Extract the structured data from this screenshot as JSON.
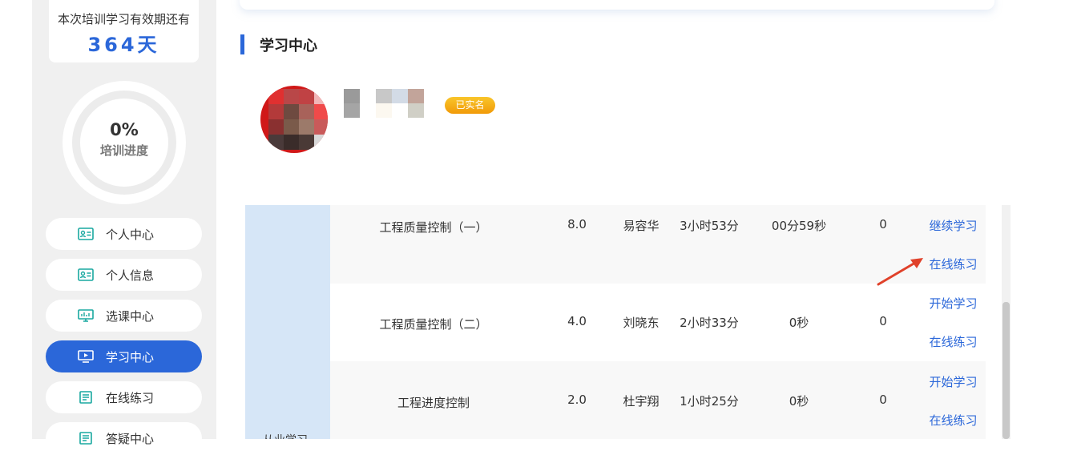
{
  "validity": {
    "label": "本次培训学习有效期还有",
    "days": "364天"
  },
  "progress": {
    "percent_text": "0%",
    "label": "培训进度",
    "value": 0
  },
  "menu": [
    {
      "label": "个人中心",
      "icon": "id-card-icon"
    },
    {
      "label": "个人信息",
      "icon": "id-card-icon"
    },
    {
      "label": "选课中心",
      "icon": "monitor-icon"
    },
    {
      "label": "学习中心",
      "icon": "play-screen-icon",
      "active": true
    },
    {
      "label": "在线练习",
      "icon": "document-icon"
    },
    {
      "label": "答疑中心",
      "icon": "document-icon"
    }
  ],
  "section": {
    "title": "学习中心"
  },
  "profile": {
    "badge": "已实名"
  },
  "table": {
    "category": "从业学习",
    "rows": [
      {
        "name": "工程质量控制（一）",
        "credit": "8.0",
        "teacher": "易容华",
        "total": "3小时53分",
        "studied": "00分59秒",
        "count": "0",
        "action1": "继续学习",
        "action2": "在线练习"
      },
      {
        "name": "工程质量控制（二）",
        "credit": "4.0",
        "teacher": "刘晓东",
        "total": "2小时33分",
        "studied": "0秒",
        "count": "0",
        "action1": "开始学习",
        "action2": "在线练习"
      },
      {
        "name": "工程进度控制",
        "credit": "2.0",
        "teacher": "杜宇翔",
        "total": "1小时25分",
        "studied": "0秒",
        "count": "0",
        "action1": "开始学习",
        "action2": "在线练习"
      }
    ]
  },
  "colors": {
    "accent": "#2b67d9",
    "badge": "#f5a516",
    "annotation_arrow": "#e0412a"
  }
}
